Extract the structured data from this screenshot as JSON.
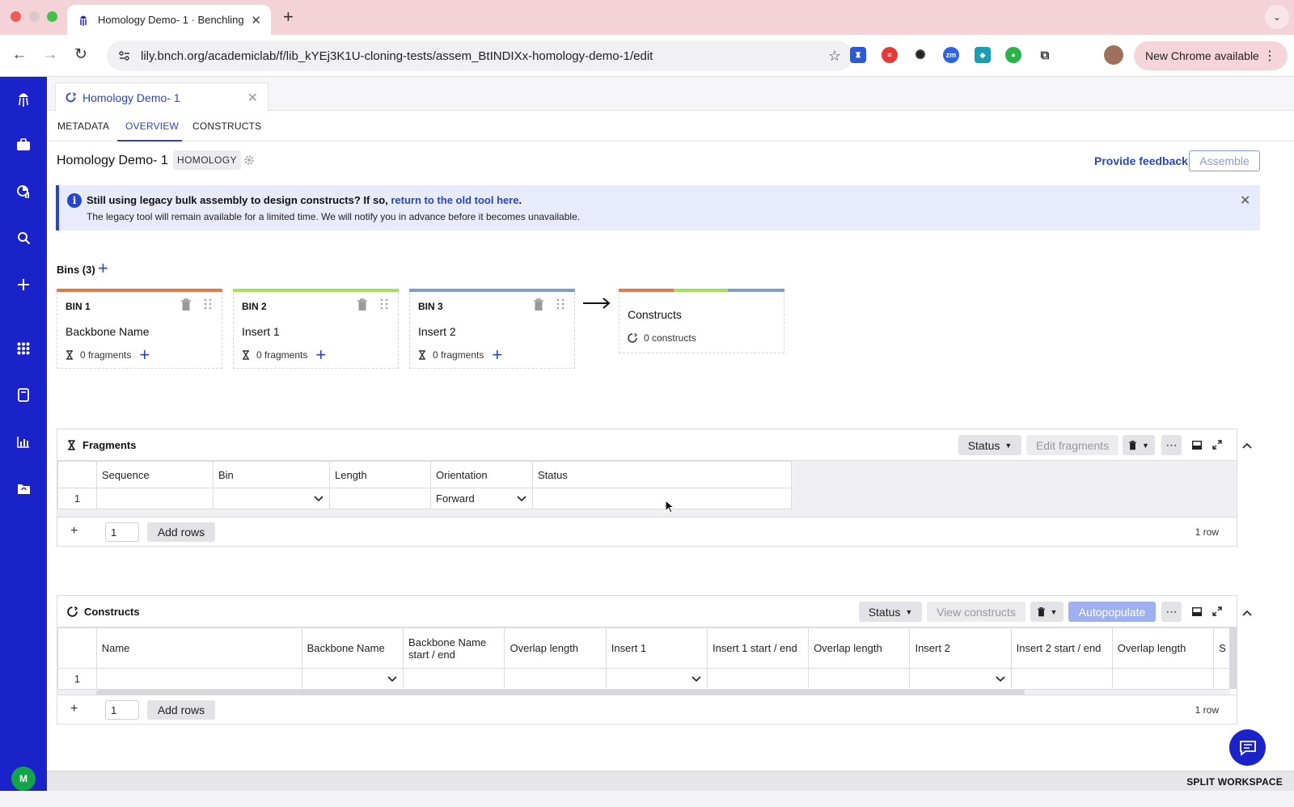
{
  "browser": {
    "tab_title": "Homology Demo- 1 · Benchling",
    "url": "lily.bnch.org/academiclab/f/lib_kYEj3K1U-cloning-tests/assem_BtINDIXx-homology-demo-1/edit",
    "update_label": "New Chrome available",
    "extensions": [
      "zm"
    ]
  },
  "app": {
    "doc_tab_label": "Homology Demo- 1",
    "subnav": [
      "METADATA",
      "OVERVIEW",
      "CONSTRUCTS"
    ],
    "active_subnav": "OVERVIEW",
    "page_title": "Homology Demo- 1",
    "tag": "HOMOLOGY",
    "feedback_label": "Provide feedback",
    "assemble_label": "Assemble",
    "banner": {
      "line1_prefix": "Still using legacy bulk assembly to design constructs? If so, ",
      "line1_link": "return to the old tool here",
      "line1_suffix": ".",
      "line2": "The legacy tool will remain available for a limited time. We will notify you in advance before it becomes unavailable."
    },
    "bins_label": "Bins (3)",
    "bins": [
      {
        "title": "BIN 1",
        "name": "Backbone Name",
        "fragments": "0 fragments",
        "color": "#e8764b"
      },
      {
        "title": "BIN 2",
        "name": "Insert 1",
        "fragments": "0 fragments",
        "color": "#9ee35a"
      },
      {
        "title": "BIN 3",
        "name": "Insert 2",
        "fragments": "0 fragments",
        "color": "#7e9ccf"
      }
    ],
    "constructs_card": {
      "title": "Constructs",
      "count": "0 constructs"
    },
    "user_initial": "M",
    "split_workspace": "SPLIT WORKSPACE"
  },
  "fragments_panel": {
    "title": "Fragments",
    "status_label": "Status",
    "edit_label": "Edit fragments",
    "columns": [
      "Sequence",
      "Bin",
      "Length",
      "Orientation",
      "Status"
    ],
    "rows": [
      {
        "num": "1",
        "sequence": "",
        "bin": "",
        "length": "",
        "orientation": "Forward",
        "status": ""
      }
    ],
    "add_count": "1",
    "add_label": "Add rows",
    "row_count": "1 row"
  },
  "constructs_panel": {
    "title": "Constructs",
    "status_label": "Status",
    "view_label": "View constructs",
    "autopopulate_label": "Autopopulate",
    "columns": [
      "Name",
      "Backbone Name",
      "Backbone Name start / end",
      "Overlap length",
      "Insert 1",
      "Insert 1 start / end",
      "Overlap length",
      "Insert 2",
      "Insert 2 start / end",
      "Overlap length",
      "S"
    ],
    "rows": [
      {
        "num": "1"
      }
    ],
    "add_count": "1",
    "add_label": "Add rows",
    "row_count": "1 row"
  },
  "colors": {
    "rail": "#1a22c9",
    "accent": "#2845c3",
    "banner_bg": "#e8ebfb"
  }
}
